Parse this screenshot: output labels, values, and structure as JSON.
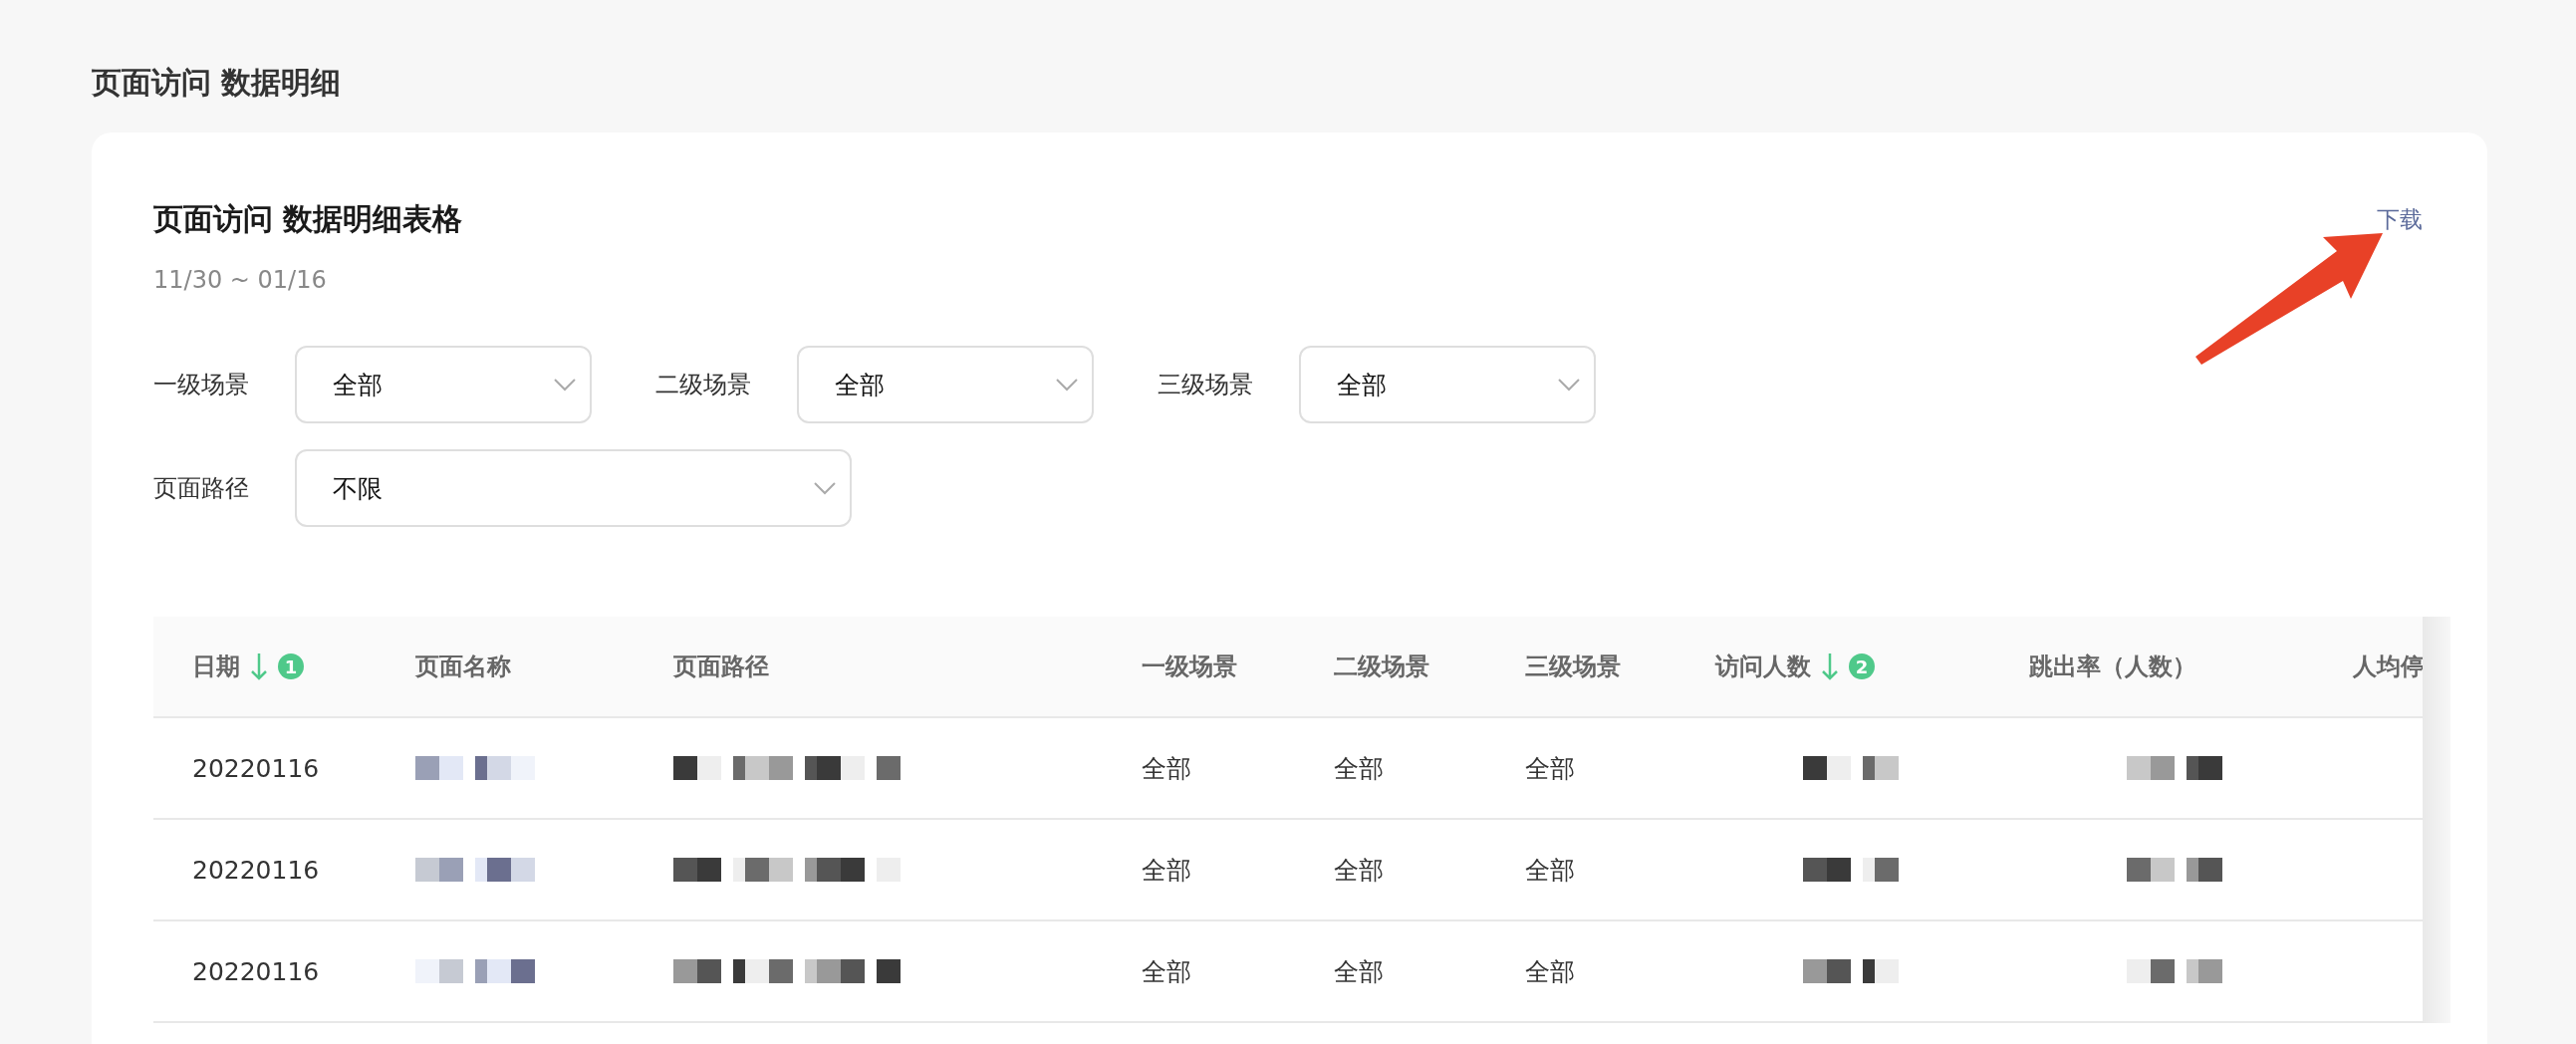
{
  "page_title": "页面访问 数据明细",
  "card": {
    "title": "页面访问 数据明细表格",
    "date_range": "11/30 ~ 01/16",
    "download_link": "下载",
    "annotation": {
      "kind": "arrow"
    },
    "filters": [
      {
        "label": "一级场景",
        "value": "全部",
        "wide": false
      },
      {
        "label": "二级场景",
        "value": "全部",
        "wide": false
      },
      {
        "label": "三级场景",
        "value": "全部",
        "wide": false
      },
      {
        "label": "页面路径",
        "value": "不限",
        "wide": true
      }
    ],
    "table": {
      "columns": [
        {
          "label": "日期",
          "sort_order": "1"
        },
        {
          "label": "页面名称"
        },
        {
          "label": "页面路径"
        },
        {
          "label": "一级场景"
        },
        {
          "label": "二级场景"
        },
        {
          "label": "三级场景"
        },
        {
          "label": "访问人数",
          "sort_order": "2"
        },
        {
          "label": "跳出率（人数）"
        },
        {
          "label": "人均停"
        }
      ],
      "rows": [
        {
          "cells": [
            {
              "kind": "text",
              "text": "20220116"
            },
            {
              "kind": "redacted"
            },
            {
              "kind": "redacted"
            },
            {
              "kind": "text",
              "text": "全部"
            },
            {
              "kind": "text",
              "text": "全部"
            },
            {
              "kind": "text",
              "text": "全部"
            },
            {
              "kind": "redacted"
            },
            {
              "kind": "redacted"
            }
          ]
        },
        {
          "cells": [
            {
              "kind": "text",
              "text": "20220116"
            },
            {
              "kind": "redacted"
            },
            {
              "kind": "redacted"
            },
            {
              "kind": "text",
              "text": "全部"
            },
            {
              "kind": "text",
              "text": "全部"
            },
            {
              "kind": "text",
              "text": "全部"
            },
            {
              "kind": "redacted"
            },
            {
              "kind": "redacted"
            }
          ]
        },
        {
          "cells": [
            {
              "kind": "text",
              "text": "20220116"
            },
            {
              "kind": "redacted"
            },
            {
              "kind": "redacted"
            },
            {
              "kind": "text",
              "text": "全部"
            },
            {
              "kind": "text",
              "text": "全部"
            },
            {
              "kind": "text",
              "text": "全部"
            },
            {
              "kind": "redacted"
            },
            {
              "kind": "redacted"
            }
          ]
        }
      ]
    }
  }
}
